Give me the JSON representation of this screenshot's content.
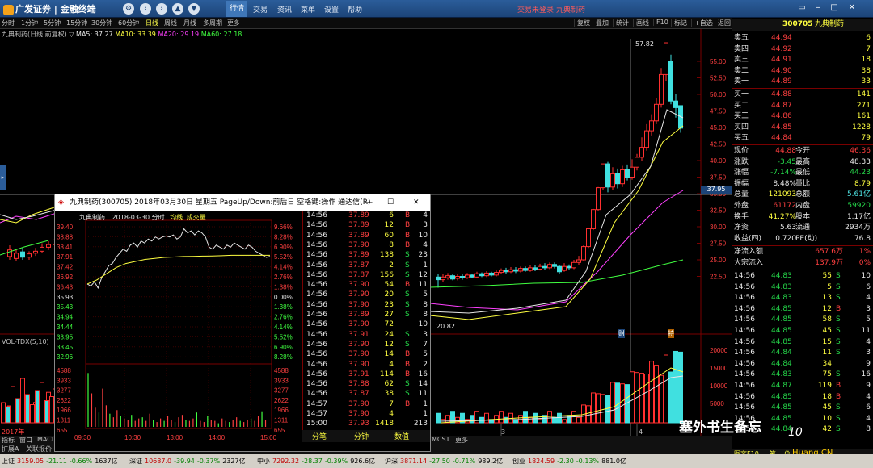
{
  "titlebar": {
    "app_name": "广发证券",
    "terminal": "金融终端",
    "login_status": "交易未登录",
    "stock_name": "九典制药",
    "menus": [
      "行情",
      "交易",
      "资讯",
      "菜单",
      "设置",
      "帮助"
    ]
  },
  "periods": [
    "分时",
    "1分钟",
    "5分钟",
    "15分钟",
    "30分钟",
    "60分钟",
    "日线",
    "周线",
    "月线",
    "多周期",
    "更多"
  ],
  "right_tools": [
    "复权",
    "叠加",
    "统计",
    "画线",
    "F10",
    "标记",
    "+自选",
    "返回"
  ],
  "main": {
    "header": "九典制药(日线 前复权)",
    "ma5": "MA5: 37.27",
    "ma10": "MA10: 33.39",
    "ma20": "MA20: 29.19",
    "ma60": "MA60: 27.18",
    "y_labels": [
      "55.00",
      "52.50",
      "50.00",
      "47.50",
      "45.00",
      "42.50",
      "40.00",
      "37.50",
      "35.00",
      "32.50",
      "30.00",
      "27.50",
      "25.00",
      "22.50"
    ],
    "hi_label": "57.82",
    "lo_label": "20.82",
    "cursor_price": "37.95",
    "vol_label": "VOL-TDX(5,10)",
    "vol_y": [
      "20000",
      "15000",
      "10000",
      "5000"
    ],
    "year_label": "2017年",
    "m3": "3",
    "m4": "4",
    "cai": "财",
    "te": "特"
  },
  "quote": {
    "code": "300705",
    "name": "九典制药",
    "asks": [
      {
        "l": "卖五",
        "p": "44.94",
        "v": "6"
      },
      {
        "l": "卖四",
        "p": "44.92",
        "v": "7"
      },
      {
        "l": "卖三",
        "p": "44.91",
        "v": "18"
      },
      {
        "l": "卖二",
        "p": "44.90",
        "v": "38"
      },
      {
        "l": "卖一",
        "p": "44.89",
        "v": "33"
      }
    ],
    "bids": [
      {
        "l": "买一",
        "p": "44.88",
        "v": "141"
      },
      {
        "l": "买二",
        "p": "44.87",
        "v": "271"
      },
      {
        "l": "买三",
        "p": "44.86",
        "v": "161"
      },
      {
        "l": "买四",
        "p": "44.85",
        "v": "1228"
      },
      {
        "l": "买五",
        "p": "44.84",
        "v": "79"
      }
    ],
    "stats": [
      {
        "a": "现价",
        "av": "44.88",
        "b": "今开",
        "bv": "46.36",
        "ac": "c-red",
        "bc": "c-red"
      },
      {
        "a": "涨跌",
        "av": "-3.45",
        "b": "最高",
        "bv": "48.33",
        "ac": "c-grn",
        "bc": "c-wht"
      },
      {
        "a": "涨幅",
        "av": "-7.14%",
        "b": "最低",
        "bv": "44.23",
        "ac": "c-grn",
        "bc": "c-grn"
      },
      {
        "a": "振幅",
        "av": "8.48%",
        "b": "量比",
        "bv": "8.79",
        "ac": "c-wht",
        "bc": "c-yel"
      },
      {
        "a": "总量",
        "av": "121093",
        "b": "总额",
        "bv": "5.61亿",
        "ac": "c-yel",
        "bc": "c-cy"
      },
      {
        "a": "外盘",
        "av": "61172",
        "b": "内盘",
        "bv": "59920",
        "ac": "c-red",
        "bc": "c-grn"
      },
      {
        "a": "换手",
        "av": "41.27%",
        "b": "股本",
        "bv": "1.17亿",
        "ac": "c-yel",
        "bc": "c-wht"
      },
      {
        "a": "净资",
        "av": "5.63",
        "b": "流通",
        "bv": "2934万",
        "ac": "c-wht",
        "bc": "c-wht"
      },
      {
        "a": "收益(四)",
        "av": "0.720",
        "b": "PE(动)",
        "bv": "76.8",
        "ac": "c-wht",
        "bc": "c-wht"
      }
    ],
    "flow": [
      {
        "l": "净流入额",
        "v": "657.6万",
        "p": "1%"
      },
      {
        "l": "大宗流入",
        "v": "137.9万",
        "p": "0%"
      }
    ],
    "ticks": [
      [
        "14:56",
        "44.83",
        "55",
        "S",
        "10"
      ],
      [
        "14:56",
        "44.83",
        "5",
        "S",
        "6"
      ],
      [
        "14:56",
        "44.83",
        "13",
        "S",
        "4"
      ],
      [
        "14:56",
        "44.85",
        "12",
        "B",
        "3"
      ],
      [
        "14:56",
        "44.85",
        "58",
        "S",
        "5"
      ],
      [
        "14:56",
        "44.85",
        "45",
        "S",
        "11"
      ],
      [
        "14:56",
        "44.85",
        "15",
        "S",
        "4"
      ],
      [
        "14:56",
        "44.84",
        "11",
        "S",
        "3"
      ],
      [
        "14:56",
        "44.84",
        "34",
        "",
        "9"
      ],
      [
        "14:56",
        "44.83",
        "75",
        "S",
        "16"
      ],
      [
        "14:56",
        "44.87",
        "119",
        "B",
        "9"
      ],
      [
        "14:56",
        "44.85",
        "18",
        "B",
        "4"
      ],
      [
        "14:56",
        "44.85",
        "45",
        "S",
        "6"
      ],
      [
        "14:56",
        "44.85",
        "10",
        "S",
        "4"
      ],
      [
        "14:56",
        "44.84",
        "42",
        "S",
        "8"
      ]
    ],
    "bottom_tabs": [
      "图文F10",
      "笔",
      "价"
    ]
  },
  "popup": {
    "title": "九典制药(300705) 2018年03月30日 星期五 PageUp/Down:前后日 空格键:操作 通达信(R)",
    "header": "九典制药",
    "date": "2018-03-30 分时",
    "avg": "均线",
    "volume": "成交量",
    "left_labels": [
      "39.40",
      "38.88",
      "38.41",
      "37.91",
      "37.42",
      "36.92",
      "36.43",
      "35.93",
      "35.43",
      "34.94",
      "34.44",
      "33.95",
      "33.45",
      "32.96"
    ],
    "right_labels": [
      "9.66%",
      "8.28%",
      "6.90%",
      "5.52%",
      "4.14%",
      "2.76%",
      "1.38%",
      "0.00%",
      "1.38%",
      "2.76%",
      "4.14%",
      "5.52%",
      "6.90%",
      "8.28%"
    ],
    "vol_left": [
      "4588",
      "3933",
      "3277",
      "2622",
      "1966",
      "1311",
      "655"
    ],
    "vol_right": [
      "4588",
      "3933",
      "3277",
      "2622",
      "1966",
      "1311",
      "655"
    ],
    "times": [
      "09:30",
      "10:30",
      "13:00",
      "14:00",
      "15:00"
    ],
    "ticks": [
      [
        "14:56",
        "37.89",
        "6",
        "B",
        "4"
      ],
      [
        "14:56",
        "37.89",
        "12",
        "B",
        "3"
      ],
      [
        "14:56",
        "37.89",
        "60",
        "B",
        "10"
      ],
      [
        "14:56",
        "37.90",
        "8",
        "B",
        "4"
      ],
      [
        "14:56",
        "37.89",
        "138",
        "S",
        "23"
      ],
      [
        "14:56",
        "37.87",
        "2",
        "S",
        "1"
      ],
      [
        "14:56",
        "37.87",
        "156",
        "S",
        "12"
      ],
      [
        "14:56",
        "37.90",
        "54",
        "B",
        "11"
      ],
      [
        "14:56",
        "37.90",
        "20",
        "S",
        "5"
      ],
      [
        "14:56",
        "37.90",
        "23",
        "S",
        "8"
      ],
      [
        "14:56",
        "37.89",
        "27",
        "S",
        "8"
      ],
      [
        "14:56",
        "37.90",
        "72",
        "",
        "10"
      ],
      [
        "14:56",
        "37.91",
        "24",
        "S",
        "3"
      ],
      [
        "14:56",
        "37.90",
        "12",
        "S",
        "7"
      ],
      [
        "14:56",
        "37.90",
        "14",
        "B",
        "5"
      ],
      [
        "14:56",
        "37.90",
        "4",
        "B",
        "2"
      ],
      [
        "14:56",
        "37.91",
        "114",
        "B",
        "16"
      ],
      [
        "14:56",
        "37.88",
        "62",
        "S",
        "14"
      ],
      [
        "14:56",
        "37.87",
        "38",
        "S",
        "11"
      ],
      [
        "14:57",
        "37.90",
        "7",
        "B",
        "1"
      ],
      [
        "14:57",
        "37.90",
        "4",
        "",
        "1"
      ],
      [
        "15:00",
        "37.93",
        "1418",
        "",
        "213"
      ]
    ],
    "tabs": [
      "分笔",
      "分钟",
      "数值"
    ]
  },
  "left_tabs": [
    "指标",
    "窗口",
    "MACD",
    "扩展A",
    "关联报价"
  ],
  "bottom_left_tabs": [
    "MCST",
    "更多"
  ],
  "statusbar": {
    "items": [
      {
        "t": "上证",
        "v": "3159.05",
        "c": "-21.11",
        "p": "-0.66%",
        "a": "1637亿"
      },
      {
        "t": "深证",
        "v": "10687.0",
        "c": "-39.94",
        "p": "-0.37%",
        "a": "2327亿"
      },
      {
        "t": "中小",
        "v": "7292.32",
        "c": "-28.37",
        "p": "-0.39%",
        "a": "926.6亿"
      },
      {
        "t": "沪深",
        "v": "3871.14",
        "c": "-27.50",
        "p": "-0.71%",
        "a": "989.2亿"
      },
      {
        "t": "创业",
        "v": "1824.59",
        "c": "-2.30",
        "p": "-0.13%",
        "a": "881.0亿"
      }
    ]
  },
  "watermark": {
    "text": "塞外书生备忘",
    "site": "Huang.CN",
    "num": "10"
  }
}
